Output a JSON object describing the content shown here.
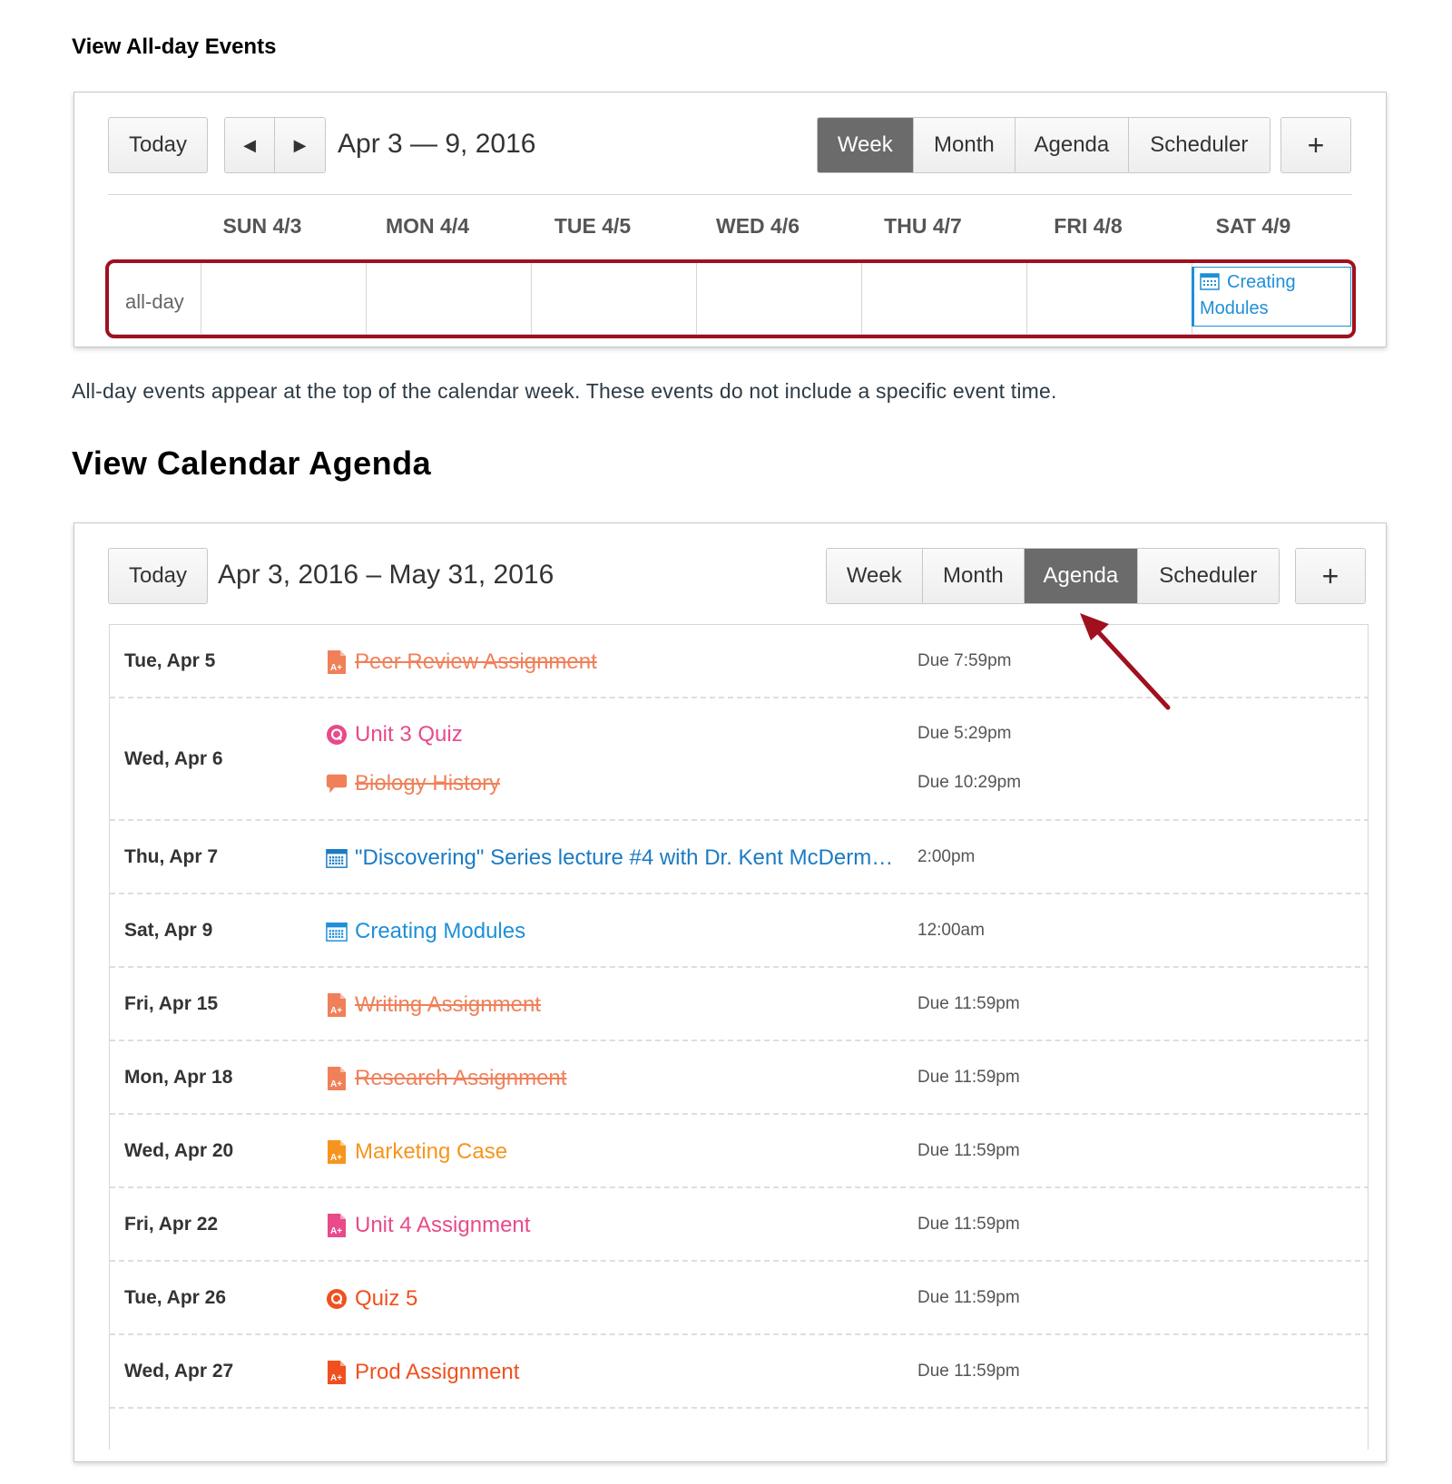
{
  "section1": {
    "heading": "View All-day Events",
    "toolbar": {
      "today": "Today",
      "prev": "◀",
      "next": "▶",
      "date_range": "Apr 3 — 9, 2016",
      "views": [
        "Week",
        "Month",
        "Agenda",
        "Scheduler"
      ],
      "active_view": "Week",
      "add": "+"
    },
    "days": [
      "SUN 4/3",
      "MON 4/4",
      "TUE 4/5",
      "WED 4/6",
      "THU 4/7",
      "FRI 4/8",
      "SAT 4/9"
    ],
    "allday_label": "all-day",
    "allday_event": {
      "title_line1": "Creating",
      "title_line2": "Modules",
      "day": "SAT 4/9"
    }
  },
  "caption": "All-day events appear at the top of the calendar week. These events do not include a specific event time.",
  "section2": {
    "heading": "View Calendar Agenda",
    "toolbar": {
      "today": "Today",
      "date_range": "Apr 3, 2016 – May 31, 2016",
      "views": [
        "Week",
        "Month",
        "Agenda",
        "Scheduler"
      ],
      "active_view": "Agenda",
      "add": "+"
    },
    "agenda": [
      {
        "date": "Tue, Apr 5",
        "items": [
          {
            "icon": "assignment-icon",
            "title": "Peer Review Assignment",
            "time": "Due 7:59pm",
            "color": "#f0805a",
            "struck": true
          }
        ]
      },
      {
        "date": "Wed, Apr 6",
        "items": [
          {
            "icon": "quiz-icon",
            "title": "Unit 3 Quiz",
            "time": "Due 5:29pm",
            "color": "#e84a8a",
            "struck": false
          },
          {
            "icon": "discussion-icon",
            "title": "Biology History",
            "time": "Due 10:29pm",
            "color": "#f0805a",
            "struck": true
          }
        ]
      },
      {
        "date": "Thu, Apr 7",
        "items": [
          {
            "icon": "calendar-event-icon",
            "title": "\"Discovering\" Series lecture #4 with Dr. Kent McDerm…",
            "time": "2:00pm",
            "color": "#1a7bc4",
            "struck": false
          }
        ]
      },
      {
        "date": "Sat, Apr 9",
        "items": [
          {
            "icon": "calendar-event-icon",
            "title": "Creating Modules",
            "time": "12:00am",
            "color": "#1e8fd9",
            "struck": false
          }
        ]
      },
      {
        "date": "Fri, Apr 15",
        "items": [
          {
            "icon": "assignment-icon",
            "title": "Writing Assignment",
            "time": "Due 11:59pm",
            "color": "#f0805a",
            "struck": true
          }
        ]
      },
      {
        "date": "Mon, Apr 18",
        "items": [
          {
            "icon": "assignment-icon",
            "title": "Research Assignment",
            "time": "Due 11:59pm",
            "color": "#f0805a",
            "struck": true
          }
        ]
      },
      {
        "date": "Wed, Apr 20",
        "items": [
          {
            "icon": "assignment-icon",
            "title": "Marketing Case",
            "time": "Due 11:59pm",
            "color": "#f7941d",
            "struck": false
          }
        ]
      },
      {
        "date": "Fri, Apr 22",
        "items": [
          {
            "icon": "assignment-icon",
            "title": "Unit 4 Assignment",
            "time": "Due 11:59pm",
            "color": "#e84a8a",
            "struck": false
          }
        ]
      },
      {
        "date": "Tue, Apr 26",
        "items": [
          {
            "icon": "quiz-icon",
            "title": "Quiz 5",
            "time": "Due 11:59pm",
            "color": "#f0501e",
            "struck": false
          }
        ]
      },
      {
        "date": "Wed, Apr 27",
        "items": [
          {
            "icon": "assignment-icon",
            "title": "Prod Assignment",
            "time": "Due 11:59pm",
            "color": "#f0501e",
            "struck": false
          }
        ]
      }
    ]
  },
  "colors": {
    "highlight": "#a0101e",
    "active_button": "#6b6b6b",
    "event_blue": "#1e8fd9",
    "arrow": "#a0101e"
  }
}
